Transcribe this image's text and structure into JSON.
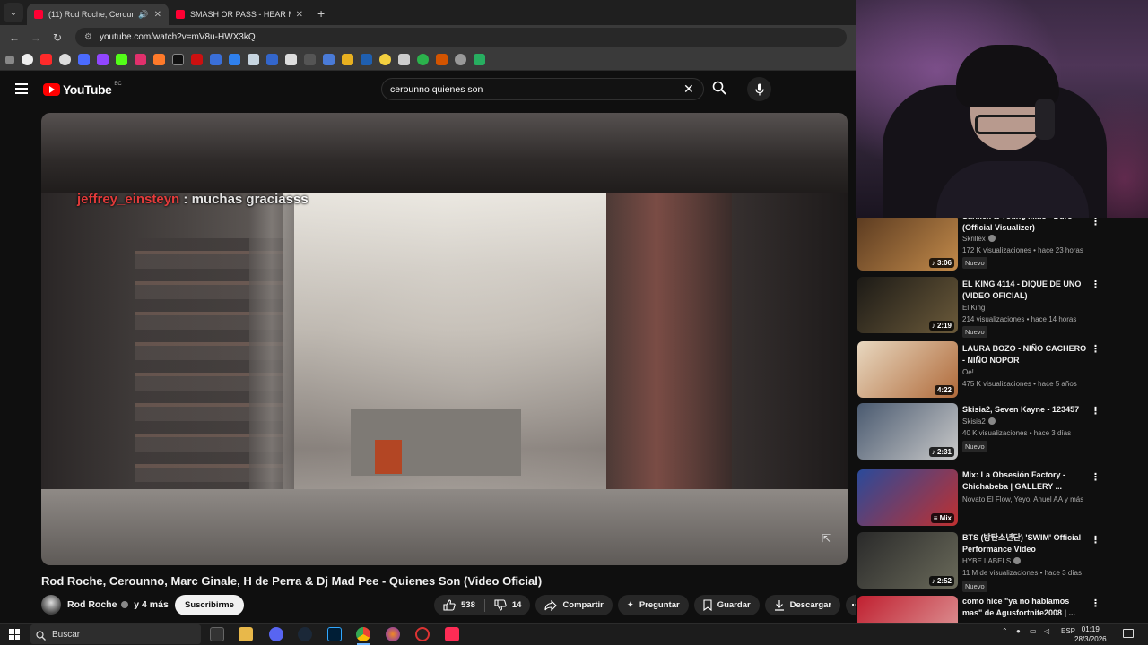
{
  "browser": {
    "tabs": [
      {
        "title": "(11) Rod Roche, Cerounno,",
        "active": true
      },
      {
        "title": "SMASH OR PASS - HEAR ME OUT",
        "active": false
      }
    ],
    "url": "youtube.com/watch?v=mV8u-HWX3kQ",
    "new_tab": "+"
  },
  "youtube": {
    "logo_text": "YouTube",
    "country_code": "EC",
    "search_value": "cerounno quienes son"
  },
  "video": {
    "chat_user": "jeffrey_einsteyn",
    "chat_message": " : muchas graciasss",
    "title": "Rod Roche, Cerounno, Marc Ginale, H de Perra & Dj Mad Pee - Quienes Son (Video Oficial)",
    "channel": "Rod Roche",
    "channel_extra": "y 4 más",
    "subscribe_label": "Suscribirme",
    "likes": "538",
    "dislikes": "14",
    "share_label": "Compartir",
    "ask_label": "Preguntar",
    "save_label": "Guardar",
    "download_label": "Descargar"
  },
  "recommendations": [
    {
      "title": "Skrillex & Young Miko - Duro (Official Visualizer)",
      "channel": "Skrillex",
      "verified": true,
      "meta": "172 K visualizaciones • hace 23 horas",
      "badge": "Nuevo",
      "duration": "3:06",
      "color_a": "#5a3a20",
      "color_b": "#c28a4a"
    },
    {
      "title": "EL KING 4114 - DIQUE DE UNO (VIDEO OFICIAL)",
      "channel": "El King",
      "verified": false,
      "meta": "214 visualizaciones • hace 14 horas",
      "badge": "Nuevo",
      "duration": "2:19",
      "color_a": "#1c1a16",
      "color_b": "#6b5a3a"
    },
    {
      "title": "LAURA BOZO - NIÑO CACHERO - NIÑO NOPOR",
      "channel": "Oe!",
      "verified": false,
      "meta": "475 K visualizaciones • hace 5 años",
      "badge": "",
      "duration": "4:22",
      "color_a": "#e8d8c0",
      "color_b": "#b06a3a"
    },
    {
      "title": "Skisia2, Seven Kayne - 123457",
      "channel": "Skisia2",
      "verified": true,
      "meta": "40 K visualizaciones • hace 3 días",
      "badge": "Nuevo",
      "duration": "2:31",
      "color_a": "#4a5a70",
      "color_b": "#c9c9c9"
    },
    {
      "title": "Mix: La Obsesión Factory - Chichabeba | GALLERY ...",
      "channel": "Novato El Flow, Yeyo, Anuel AA y más",
      "verified": false,
      "meta": "",
      "badge": "",
      "duration": "Mix",
      "color_a": "#2a4a9a",
      "color_b": "#c03030"
    },
    {
      "title": "BTS (방탄소년단) 'SWIM' Official Performance Video",
      "channel": "HYBE LABELS",
      "verified": true,
      "meta": "11 M de visualizaciones • hace 3 días",
      "badge": "Nuevo",
      "duration": "2:52",
      "color_a": "#2a2a2a",
      "color_b": "#6a6a5a"
    },
    {
      "title": "como hice \"ya no hablamos mas\" de Agusfortnite2008 | ...",
      "channel": "",
      "verified": false,
      "meta": "",
      "badge": "",
      "duration": "",
      "color_a": "#c02030",
      "color_b": "#e0a0a0"
    }
  ],
  "taskbar": {
    "search_label": "Buscar",
    "lang": "ESP",
    "time": "01:19",
    "date": "28/3/2026"
  }
}
